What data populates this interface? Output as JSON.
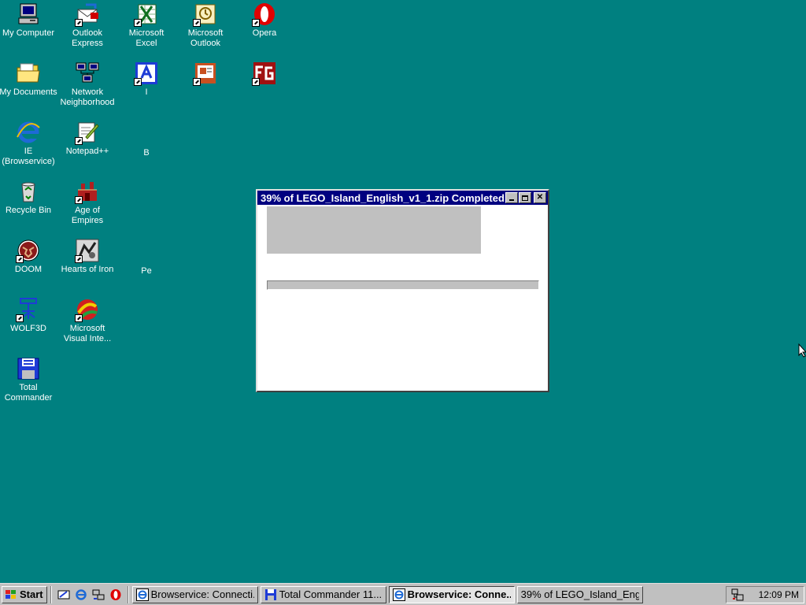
{
  "desktop": {
    "icons": [
      {
        "label": "My Computer"
      },
      {
        "label": "Outlook Express"
      },
      {
        "label": "Microsoft Excel"
      },
      {
        "label": "Microsoft Outlook"
      },
      {
        "label": "Opera"
      },
      {
        "label": "My Documents"
      },
      {
        "label": "Network Neighborhood"
      },
      {
        "label": "I"
      },
      {
        "label": ""
      },
      {
        "label": ""
      },
      {
        "label": "IE (Browservice)"
      },
      {
        "label": "Notepad++"
      },
      {
        "label": "B"
      },
      {
        "label": "Recycle Bin"
      },
      {
        "label": "Age of Empires"
      },
      {
        "label": "DOOM"
      },
      {
        "label": "Hearts of Iron"
      },
      {
        "label": "Pe"
      },
      {
        "label": "WOLF3D"
      },
      {
        "label": "Microsoft Visual Inte..."
      },
      {
        "label": "Total Commander"
      }
    ]
  },
  "window": {
    "title": "39% of LEGO_Island_English_v1_1.zip Completed",
    "progress_fraction": 0.39
  },
  "taskbar": {
    "start_label": "Start",
    "tasks": [
      {
        "label": "Browservice: Connecti..."
      },
      {
        "label": "Total Commander 11...."
      },
      {
        "label": "Browservice: Conne..."
      },
      {
        "label": "39% of LEGO_Island_Eng..."
      }
    ],
    "clock": "12:09 PM"
  }
}
